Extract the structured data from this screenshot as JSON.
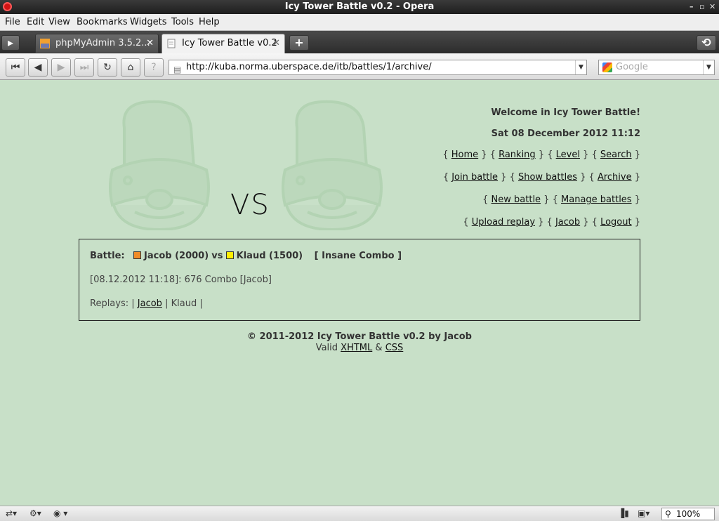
{
  "window": {
    "title": "Icy Tower Battle v0.2 - Opera"
  },
  "menu": [
    "File",
    "Edit",
    "View",
    "Bookmarks",
    "Widgets",
    "Tools",
    "Help"
  ],
  "tabs": [
    {
      "label": "phpMyAdmin 3.5.2...",
      "active": false
    },
    {
      "label": "Icy Tower Battle v0.2",
      "active": true
    }
  ],
  "address": {
    "url": "http://kuba.norma.uberspace.de/itb/battles/1/archive/"
  },
  "search": {
    "placeholder": "Google"
  },
  "page": {
    "vs": "VS",
    "welcome": "Welcome in Icy Tower Battle!",
    "datetime": "Sat 08 December 2012 11:12",
    "nav_rows": [
      [
        "Home",
        "Ranking",
        "Level",
        "Search"
      ],
      [
        "Join battle",
        "Show battles",
        "Archive"
      ],
      [
        "New battle",
        "Manage battles"
      ],
      [
        "Upload replay",
        "Jacob",
        "Logout"
      ]
    ],
    "battle": {
      "label": "Battle:",
      "player1": "Jacob (2000)",
      "player1_color": "#f08c28",
      "vs": "vs",
      "player2": "Klaud (1500)",
      "player2_color": "#ffee00",
      "mode": "[ Insane Combo ]",
      "result": "[08.12.2012 11:18]: 676 Combo [Jacob]",
      "replays_label": "Replays: |",
      "replay_link": "Jacob",
      "replay_sep": "|",
      "replay_other": "Klaud |"
    },
    "footer": {
      "copyright": "© 2011-2012 Icy Tower Battle v0.2 by Jacob",
      "valid": "Valid",
      "xhtml": "XHTML",
      "amp": "&",
      "css": "CSS"
    }
  },
  "status": {
    "zoom": "100%"
  }
}
